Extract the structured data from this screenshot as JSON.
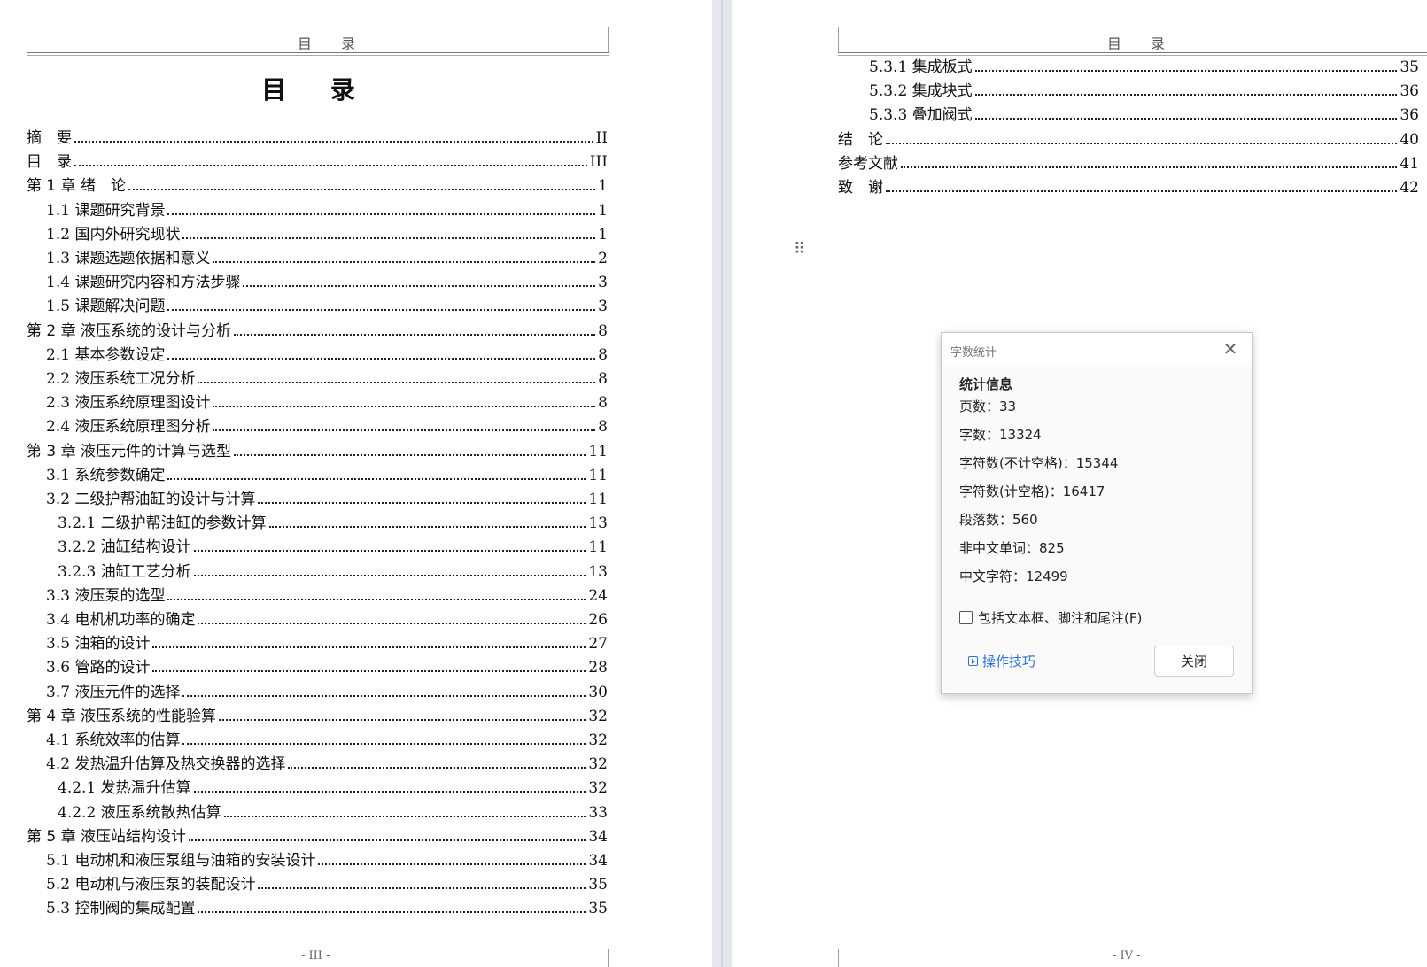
{
  "left_page": {
    "header": "目  录",
    "title": "目  录",
    "footer": "- III -",
    "toc": [
      {
        "label": "摘　要",
        "page": "II",
        "level": 0
      },
      {
        "label": "目　录",
        "page": "III",
        "level": 0
      },
      {
        "label": "第 1 章  绪　论",
        "page": "1",
        "level": 0
      },
      {
        "label": "1.1  课题研究背景",
        "page": "1",
        "level": 1
      },
      {
        "label": "1.2  国内外研究现状",
        "page": "1",
        "level": 1
      },
      {
        "label": "1.3  课题选题依据和意义",
        "page": "2",
        "level": 1
      },
      {
        "label": "1.4  课题研究内容和方法步骤",
        "page": "3",
        "level": 1
      },
      {
        "label": "1.5  课题解决问题",
        "page": "3",
        "level": 1
      },
      {
        "label": "第 2 章  液压系统的设计与分析",
        "page": "8",
        "level": 0
      },
      {
        "label": "2.1  基本参数设定",
        "page": "8",
        "level": 1
      },
      {
        "label": "2.2  液压系统工况分析",
        "page": "8",
        "level": 1
      },
      {
        "label": "2.3  液压系统原理图设计",
        "page": "8",
        "level": 1
      },
      {
        "label": "2.4  液压系统原理图分析",
        "page": "8",
        "level": 1
      },
      {
        "label": "第 3 章  液压元件的计算与选型",
        "page": "11",
        "level": 0
      },
      {
        "label": "3.1  系统参数确定",
        "page": "11",
        "level": 1
      },
      {
        "label": "3.2  二级护帮油缸的设计与计算",
        "page": "11",
        "level": 1
      },
      {
        "label": "3.2.1  二级护帮油缸的参数计算",
        "page": "13",
        "level": 2
      },
      {
        "label": "3.2.2  油缸结构设计",
        "page": "11",
        "level": 2
      },
      {
        "label": "3.2.3  油缸工艺分析",
        "page": "13",
        "level": 2
      },
      {
        "label": "3.3  液压泵的选型",
        "page": "24",
        "level": 1
      },
      {
        "label": "3.4  电机机功率的确定",
        "page": "26",
        "level": 1
      },
      {
        "label": "3.5  油箱的设计",
        "page": "27",
        "level": 1
      },
      {
        "label": "3.6  管路的设计",
        "page": "28",
        "level": 1
      },
      {
        "label": "3.7  液压元件的选择",
        "page": "30",
        "level": 1
      },
      {
        "label": "第 4 章  液压系统的性能验算",
        "page": "32",
        "level": 0
      },
      {
        "label": "4.1  系统效率的估算",
        "page": "32",
        "level": 1
      },
      {
        "label": "4.2  发热温升估算及热交换器的选择",
        "page": "32",
        "level": 1
      },
      {
        "label": "4.2.1  发热温升估算",
        "page": "32",
        "level": 2
      },
      {
        "label": "4.2.2  液压系统散热估算",
        "page": "33",
        "level": 2
      },
      {
        "label": "第 5 章  液压站结构设计",
        "page": "34",
        "level": 0
      },
      {
        "label": "5.1  电动机和液压泵组与油箱的安装设计",
        "page": "34",
        "level": 1
      },
      {
        "label": "5.2  电动机与液压泵的装配设计",
        "page": "35",
        "level": 1
      },
      {
        "label": "5.3  控制阀的集成配置",
        "page": "35",
        "level": 1
      }
    ]
  },
  "right_page": {
    "header": "目  录",
    "footer": "- IV -",
    "toc": [
      {
        "label": "5.3.1  集成板式",
        "page": "35",
        "level": 2
      },
      {
        "label": "5.3.2  集成块式",
        "page": "36",
        "level": 2
      },
      {
        "label": "5.3.3  叠加阀式",
        "page": "36",
        "level": 2
      },
      {
        "label": "结　论",
        "page": "40",
        "level": 0
      },
      {
        "label": "参考文献",
        "page": "41",
        "level": 0
      },
      {
        "label": "致　谢",
        "page": "42",
        "level": 0
      }
    ]
  },
  "dialog": {
    "title": "字数统计",
    "section": "统计信息",
    "stats": [
      "页数：33",
      "字数：13324",
      "字符数(不计空格)：15344",
      "字符数(计空格)：16417",
      "段落数：560",
      "非中文单词：825",
      "中文字符：12499"
    ],
    "checkbox_label": "包括文本框、脚注和尾注(F)",
    "checkbox_checked": false,
    "tips_label": "操作技巧",
    "close_button": "关闭",
    "close_icon": "close-icon"
  }
}
